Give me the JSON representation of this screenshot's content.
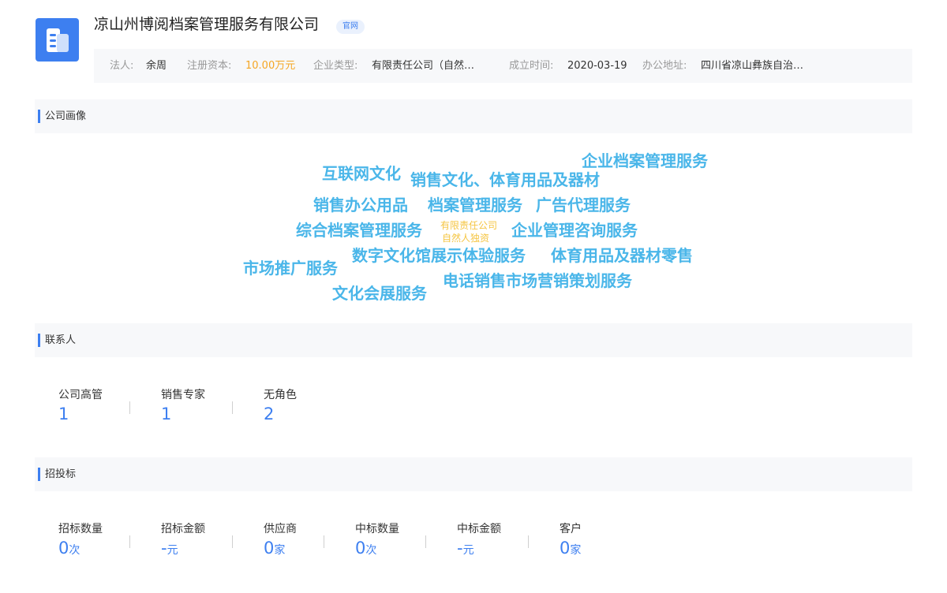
{
  "company": {
    "name": "凉山州博阅档案管理服务有限公司",
    "tag": "官网",
    "logo_icon": "building-icon",
    "accent_color": "#3d7ff0"
  },
  "info": {
    "legal_person_label": "法人:",
    "legal_person": "余周",
    "capital_label": "注册资本:",
    "capital": "10.00万元",
    "type_label": "企业类型:",
    "type": "有限责任公司（自然…",
    "founded_label": "成立时间:",
    "founded": "2020-03-19",
    "address_label": "办公地址:",
    "address": "四川省凉山彝族自治…"
  },
  "portrait": {
    "title": "公司画像",
    "words": [
      "企业档案管理服务",
      "互联网文化",
      "销售文化、体育用品及器材",
      "销售办公用品",
      "档案管理服务",
      "广告代理服务",
      "综合档案管理服务",
      "有限责任公司",
      "自然人独资",
      "企业管理咨询服务",
      "数字文化馆展示体验服务",
      "体育用品及器材零售",
      "市场推广服务",
      "电话销售市场营销策划服务",
      "文化会展服务"
    ]
  },
  "contacts": {
    "title": "联系人",
    "stats": [
      {
        "label": "公司高管",
        "value": "1"
      },
      {
        "label": "销售专家",
        "value": "1"
      },
      {
        "label": "无角色",
        "value": "2"
      }
    ]
  },
  "bidding": {
    "title": "招投标",
    "stats": [
      {
        "label": "招标数量",
        "value": "0",
        "unit": "次"
      },
      {
        "label": "招标金额",
        "value": "-",
        "unit": "元"
      },
      {
        "label": "供应商",
        "value": "0",
        "unit": "家"
      },
      {
        "label": "中标数量",
        "value": "0",
        "unit": "次"
      },
      {
        "label": "中标金额",
        "value": "-",
        "unit": "元"
      },
      {
        "label": "客户",
        "value": "0",
        "unit": "家"
      }
    ]
  }
}
